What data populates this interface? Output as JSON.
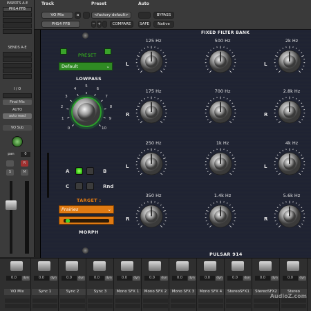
{
  "left_strip": {
    "inserts_label": "INSERTS A-E",
    "insert_slot": "PH14 FFB",
    "sends_label": "SENDS A-E",
    "io_label": "I / O",
    "output_label": "Final Mix",
    "auto_label": "AUTO",
    "auto_mode": "auto read",
    "group": "VO Sub",
    "pan_label": "pan",
    "pan_value": "0",
    "s_label": "S",
    "m_label": "M",
    "r_label": "R"
  },
  "header": {
    "track_label": "Track",
    "preset_label": "Preset",
    "auto_label": "Auto",
    "track_name": "VO Mix",
    "track_letter": "a",
    "preset_name": "<factory default>",
    "minus": "−",
    "plus": "+",
    "insert_name": "PH14 FFB",
    "compare_label": "COMPARE",
    "bypass_label": "BYPASS",
    "safe_label": "SAFE",
    "native_label": "Native"
  },
  "plugin": {
    "fixed_filter_bank": "FIXED FILTER BANK",
    "preset_label": "PRESET",
    "preset_value": "Default",
    "lowpass_label": "LOWPASS",
    "lowpass_scale": [
      "0",
      "1",
      "2",
      "3",
      "4",
      "5",
      "6",
      "7",
      "8",
      "9",
      "10"
    ],
    "target_label": "TARGET :",
    "target_value": "Prairies",
    "morph_label": "MORPH",
    "morph_position": 0.05,
    "btn_a": "A",
    "btn_b": "B",
    "btn_c": "C",
    "btn_rnd": "Rnd",
    "brand": "PULSAR 914",
    "bands": [
      {
        "freq": "125 Hz",
        "side": "L"
      },
      {
        "freq": "500 Hz",
        "side": ""
      },
      {
        "freq": "2k Hz",
        "side": "L"
      },
      {
        "freq": "175 Hz",
        "side": "R"
      },
      {
        "freq": "700 Hz",
        "side": ""
      },
      {
        "freq": "2.8k Hz",
        "side": "R"
      },
      {
        "freq": "250 Hz",
        "side": "L"
      },
      {
        "freq": "1k Hz",
        "side": ""
      },
      {
        "freq": "4k Hz",
        "side": "L"
      },
      {
        "freq": "350 Hz",
        "side": "R"
      },
      {
        "freq": "1.4k Hz",
        "side": ""
      },
      {
        "freq": "5.6k Hz",
        "side": "R"
      }
    ]
  },
  "mixer": {
    "channels": [
      {
        "name": "VO Mix",
        "value": "0.0",
        "dyn": "dyn"
      },
      {
        "name": "Sync 1",
        "value": "0.0",
        "dyn": "dyn"
      },
      {
        "name": "Sync 2",
        "value": "0.0",
        "dyn": "dyn"
      },
      {
        "name": "Sync 3",
        "value": "0.0",
        "dyn": "dyn"
      },
      {
        "name": "Mono SFX 1",
        "value": "0.0",
        "dyn": "dyn"
      },
      {
        "name": "Mono SFX 2",
        "value": "0.0",
        "dyn": "dyn"
      },
      {
        "name": "Mono SFX 3",
        "value": "0.0",
        "dyn": "dyn"
      },
      {
        "name": "Mono SFX 4",
        "value": "0.0",
        "dyn": "dyn"
      },
      {
        "name": "StereoSFX1",
        "value": "0.0",
        "dyn": "dyn"
      },
      {
        "name": "StereoSFX2",
        "value": "0.0",
        "dyn": "dyn"
      },
      {
        "name": "Stereo",
        "value": "0.0",
        "dyn": "dyn"
      }
    ],
    "watermark": "AudioZ.com"
  },
  "colors": {
    "accent_green": "#3bcc1b",
    "accent_orange": "#e07a12",
    "panel": "#1f2331"
  }
}
